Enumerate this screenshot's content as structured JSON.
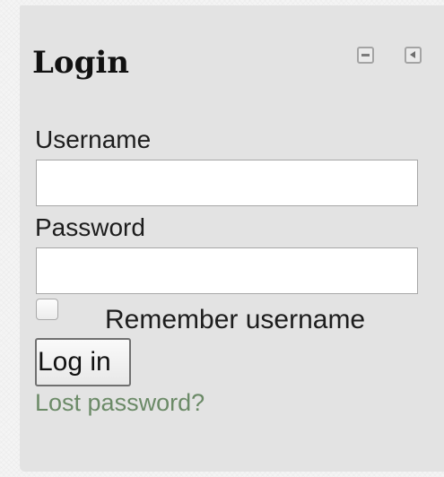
{
  "block": {
    "title": "Login",
    "controls": {
      "minimize_icon": "minimize-icon",
      "dock_icon": "chevron-left-icon"
    }
  },
  "form": {
    "username_label": "Username",
    "username_value": "",
    "password_label": "Password",
    "password_value": "",
    "remember_label": "Remember username",
    "remember_checked": false,
    "submit_label": "Log in",
    "lost_password_link": "Lost password?"
  },
  "colors": {
    "block_background": "#e3e3e3",
    "link": "#6b8a67",
    "text": "#1d1d1d"
  }
}
